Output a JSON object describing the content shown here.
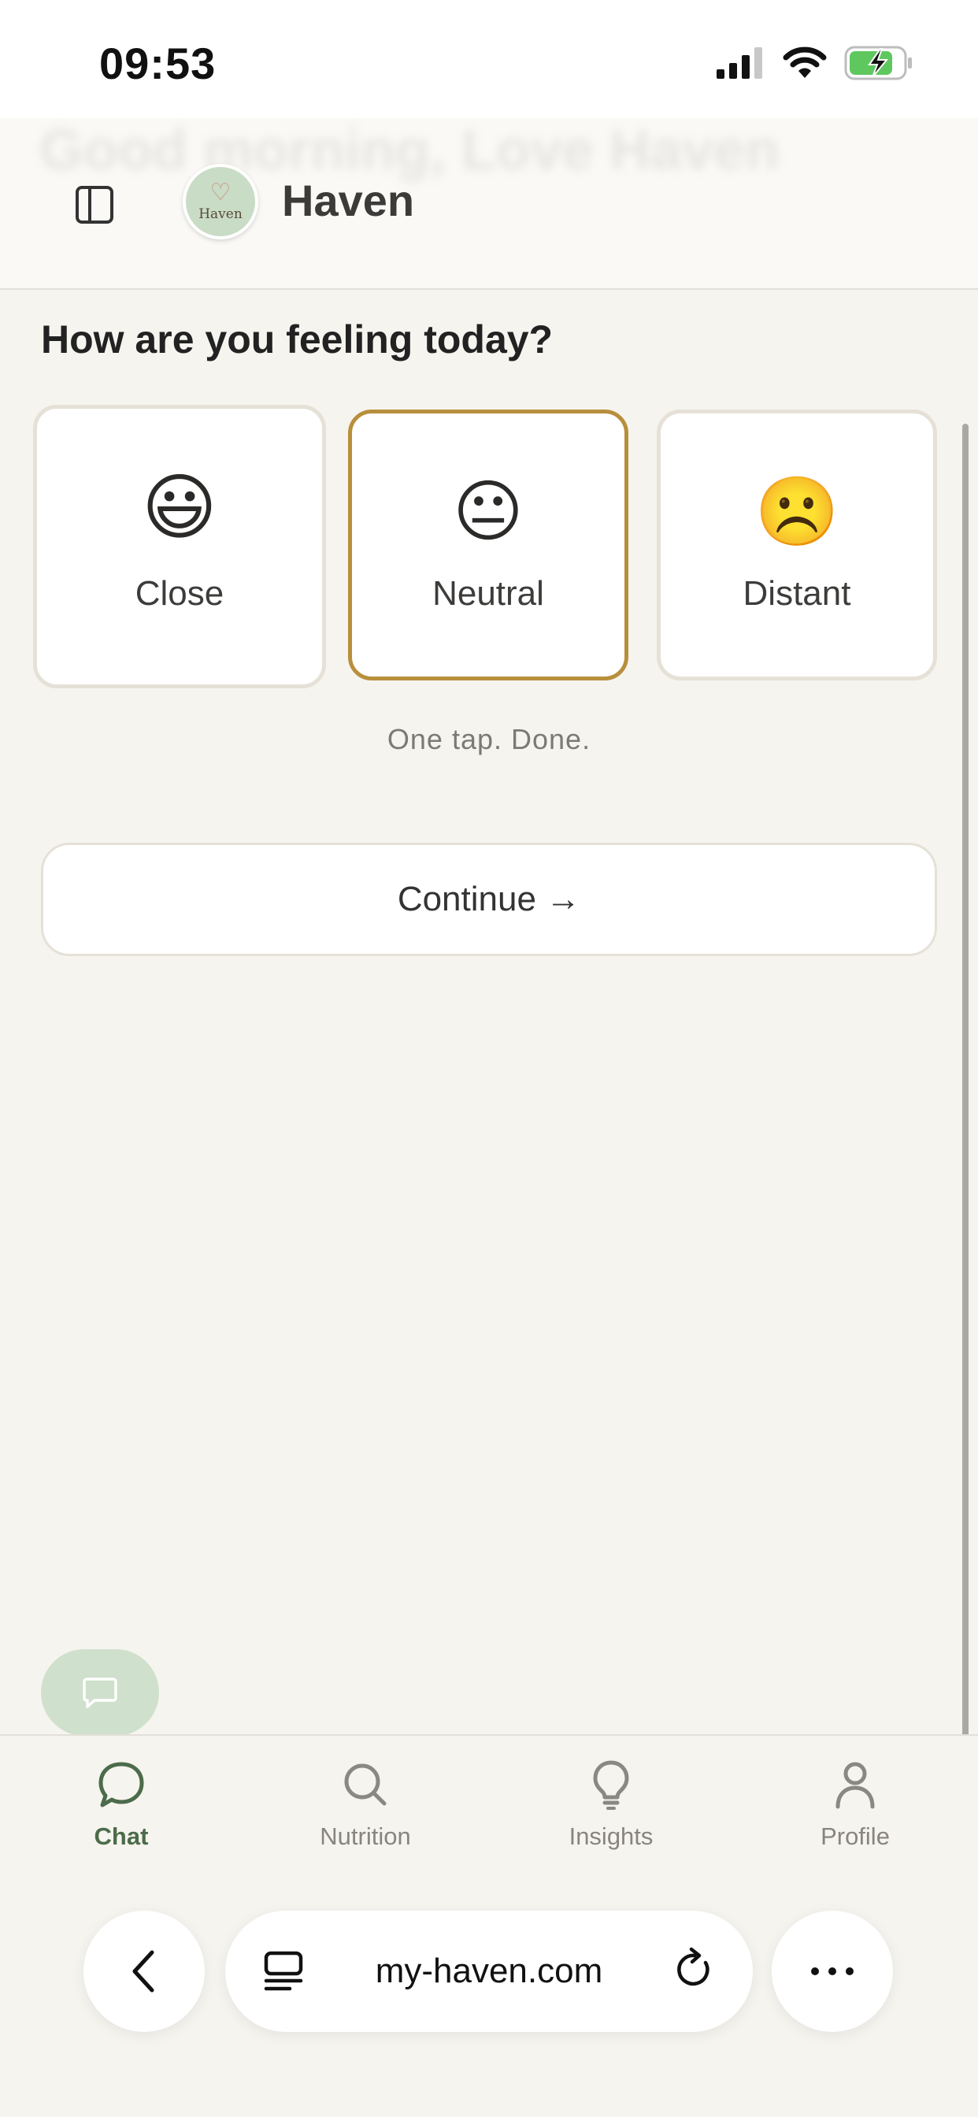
{
  "status_bar": {
    "time": "09:53"
  },
  "header": {
    "ghost_text": "Good morning, Love Haven",
    "logo_text": "Haven",
    "title": "Haven"
  },
  "main": {
    "question": "How are you feeling today?",
    "moods": [
      {
        "label": "Close",
        "emoji": "😃",
        "selected": false
      },
      {
        "label": "Neutral",
        "emoji": "😐",
        "selected": true
      },
      {
        "label": "Distant",
        "emoji": "☹️",
        "selected": false
      }
    ],
    "hint": "One tap. Done.",
    "continue_label": "Continue →"
  },
  "nav": {
    "items": [
      {
        "label": "Chat",
        "icon": "chat-bubble-icon",
        "active": true
      },
      {
        "label": "Nutrition",
        "icon": "search-icon",
        "active": false
      },
      {
        "label": "Insights",
        "icon": "lightbulb-icon",
        "active": false
      },
      {
        "label": "Profile",
        "icon": "person-icon",
        "active": false
      }
    ]
  },
  "browser": {
    "url": "my-haven.com"
  },
  "colors": {
    "background": "#f6f4ef",
    "selected_border": "#b88f3c",
    "accent_green": "#4c6b4a",
    "fab_green": "#cfe0cc",
    "battery_green": "#5ec85e"
  }
}
